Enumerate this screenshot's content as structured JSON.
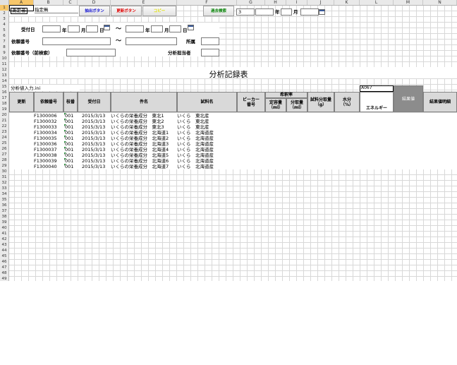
{
  "columns": [
    "A",
    "B",
    "C",
    "D",
    "E",
    "F",
    "G",
    "H",
    "I",
    "J",
    "K",
    "L",
    "M",
    "N"
  ],
  "rows": [
    "1",
    "2",
    "3",
    "4",
    "5",
    "6",
    "7",
    "8",
    "9",
    "10",
    "11",
    "12",
    "13",
    "14",
    "15",
    "16",
    "17",
    "18",
    "19",
    "20",
    "21",
    "22",
    "23",
    "24",
    "25",
    "26",
    "27",
    "28",
    "29",
    "30",
    "31",
    "32",
    "33",
    "34",
    "35",
    "36",
    "37",
    "38",
    "39",
    "40",
    "41",
    "42",
    "43",
    "44",
    "45",
    "46",
    "47",
    "48",
    "49"
  ],
  "header": {
    "measurer_label": "測定者",
    "measurer_value": "指定無",
    "extract_button": "抽出ボタン",
    "update_button": "更新ボタン",
    "copy_button": "コピー",
    "past_search_button": "過去検索",
    "year_value": "3",
    "year_label": "年",
    "month_label": "月",
    "day_label": "日"
  },
  "filters": {
    "reception_date_label": "受付日",
    "year_label": "年",
    "month_label": "月",
    "day_label": "日",
    "tilde": "～",
    "request_number_label": "依頼番号",
    "department_label": "所属",
    "request_number_pre_label": "依頼番号（前検索）",
    "analyst_label": "分析担当者"
  },
  "sheet_title": "分析記録表",
  "ini_label": "分析値入力.ini",
  "code_cell": "A067",
  "table_headers": {
    "update": "更新",
    "request_number": "依頼番号",
    "branch": "枝番",
    "reception_date": "受付日",
    "subject": "件名",
    "sample_name": "試料名",
    "beaker": "ビーカー番号",
    "dilution": "希釈率",
    "fixed_volume": "定容量（ml）",
    "portion_volume": "分取量（ml）",
    "sample_amount": "試料分取量（g）",
    "moisture": "水分（%）",
    "energy": "エネルギー",
    "result_value": "結果値",
    "result_detail": "結果値明細"
  },
  "records": [
    {
      "request": "F1300006",
      "branch": "001",
      "date": "2015/3/13",
      "subject": "いくらの栄養成分　東北1",
      "sample": "いくら　東北産"
    },
    {
      "request": "F1300032",
      "branch": "001",
      "date": "2015/3/13",
      "subject": "いくらの栄養成分　東北2",
      "sample": "いくら　東北産"
    },
    {
      "request": "F1300033",
      "branch": "001",
      "date": "2015/3/13",
      "subject": "いくらの栄養成分　東北3",
      "sample": "いくら　東北産"
    },
    {
      "request": "F1300034",
      "branch": "001",
      "date": "2015/3/13",
      "subject": "いくらの栄養成分　北海道1",
      "sample": "いくら　北海道産"
    },
    {
      "request": "F1300035",
      "branch": "001",
      "date": "2015/3/13",
      "subject": "いくらの栄養成分　北海道2",
      "sample": "いくら　北海道産"
    },
    {
      "request": "F1300036",
      "branch": "001",
      "date": "2015/3/13",
      "subject": "いくらの栄養成分　北海道3",
      "sample": "いくら　北海道産"
    },
    {
      "request": "F1300037",
      "branch": "001",
      "date": "2015/3/13",
      "subject": "いくらの栄養成分　北海道4",
      "sample": "いくら　北海道産"
    },
    {
      "request": "F1300038",
      "branch": "001",
      "date": "2015/3/13",
      "subject": "いくらの栄養成分　北海道5",
      "sample": "いくら　北海道産"
    },
    {
      "request": "F1300039",
      "branch": "001",
      "date": "2015/3/13",
      "subject": "いくらの栄養成分　北海道6",
      "sample": "いくら　北海道産"
    },
    {
      "request": "F1300040",
      "branch": "001",
      "date": "2015/3/13",
      "subject": "いくらの栄養成分　北海道7",
      "sample": "いくら　北海道産"
    }
  ],
  "colors": {
    "extract_button_text": "#1010d0",
    "update_button_text": "#e00000",
    "copy_button_text": "#e0e000",
    "past_search_button_text": "#008000",
    "selected_header": "#f7c76b",
    "table_header_bg": "#d9d9d9",
    "result_header_bg": "#8c8c8c"
  }
}
